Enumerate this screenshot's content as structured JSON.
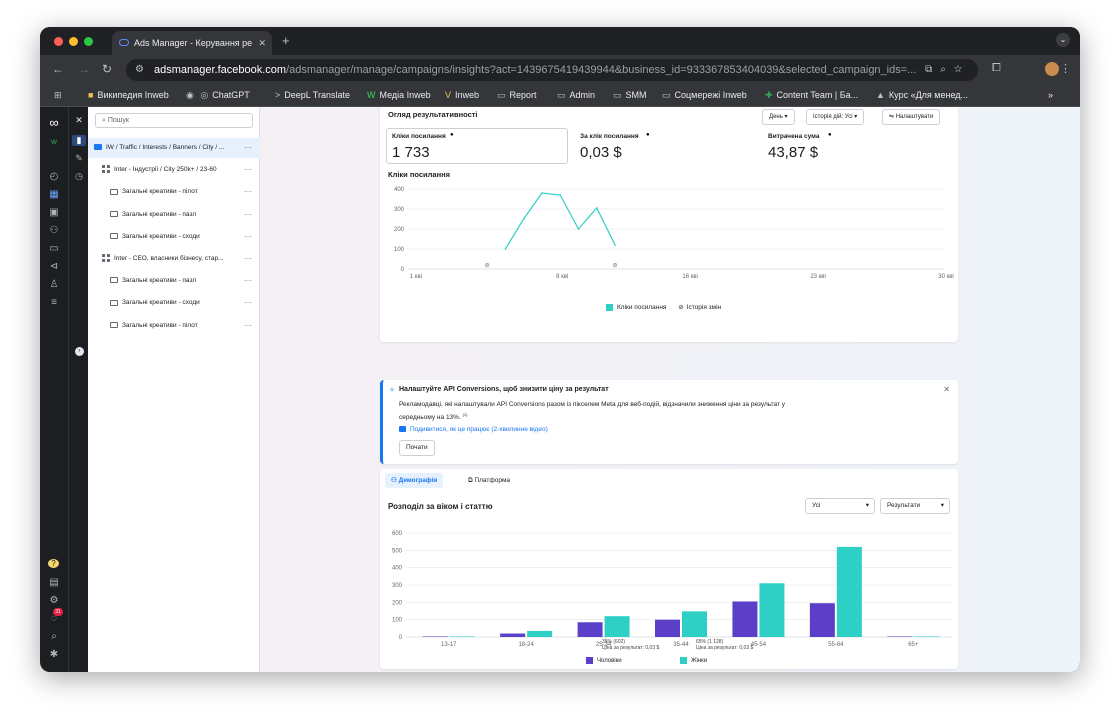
{
  "browser": {
    "tab_title": "Ads Manager - Керування ре",
    "tab_close": "✕",
    "new_tab": "+",
    "url_host": "adsmanager.facebook.com",
    "url_path": "/adsmanager/manage/campaigns/insights?act=1439675419439944&business_id=933367853404039&selected_campaign_ids=...",
    "menu": "⌄",
    "bookmarks": [
      "Википедия Inweb",
      "ChatGPT",
      "DeepL Translate",
      "Медіа Inweb",
      "Inweb",
      "Report",
      "Admin",
      "SMM",
      "Соцмережі Inweb",
      "Content Team | Ба...",
      "Курс «Для менед..."
    ],
    "bookmarks_more": "»"
  },
  "tree": {
    "search_placeholder": "Пошук",
    "rows": [
      {
        "label": "IW / Traffic / Interests / Banners / City / ...",
        "kind": "campaign",
        "indent": 0
      },
      {
        "label": "Inter - Індустрії / City 250k+ / 23-60",
        "kind": "adset",
        "indent": 1
      },
      {
        "label": "Загальні креативи - пілот",
        "kind": "ad",
        "indent": 2
      },
      {
        "label": "Загальні креативи - пазл",
        "kind": "ad",
        "indent": 2
      },
      {
        "label": "Загальні креативи - сходи",
        "kind": "ad",
        "indent": 2
      },
      {
        "label": "Inter - CEO, власники бізнесу, стар...",
        "kind": "adset",
        "indent": 1
      },
      {
        "label": "Загальні креативи - пазл",
        "kind": "ad",
        "indent": 2
      },
      {
        "label": "Загальні креативи - сходи",
        "kind": "ad",
        "indent": 2
      },
      {
        "label": "Загальні креативи - пілот",
        "kind": "ad",
        "indent": 2
      }
    ],
    "more": "···"
  },
  "overview": {
    "title": "Огляд результативності",
    "btn_day": "День ▾",
    "btn_history": "Історія дій: Усі ▾",
    "btn_settings": "Налаштувати",
    "metrics": [
      {
        "label": "Кліки посилання",
        "value": "1 733"
      },
      {
        "label": "За клік посилання",
        "value": "0,03 $"
      },
      {
        "label": "Витрачена сума",
        "value": "43,87 $"
      }
    ],
    "chart_title": "Кліки посилання",
    "legend_clicks": "Кліки посилання",
    "legend_history": "Історія змін"
  },
  "banner": {
    "title": "Налаштуйте API Conversions, щоб знизити ціну за результат",
    "body": "Рекламодавці, які налаштували API Conversions разом із пікселем Meta для веб-подій, відзначили зниження ціни за результат у середньому на 13%.",
    "footnote": "(1)",
    "video_link": "Подивитися, як це працює (2-хвилинне відео)",
    "start": "Почати",
    "close": "✕"
  },
  "breakdown": {
    "tab_demo": "Демографія",
    "tab_platform": "Платформа",
    "title": "Розподіл за віком і статтю",
    "select_all": "Усі",
    "select_results": "Результати",
    "men_label": "Чоловіки",
    "men_share": "35% (602)",
    "men_cpr": "Ціна за результат: 0,03 $",
    "women_label": "Жінки",
    "women_share": "65% (1 128)",
    "women_cpr": "Ціна за результат: 0,03 $"
  },
  "colors": {
    "men": "#5b3fc9",
    "women": "#2ecfc4",
    "line": "#2ecfc4",
    "accent": "#1877f2"
  },
  "chart_data": [
    {
      "type": "line",
      "title": "Кліки посилання",
      "x_ticks": [
        "1 кві",
        "8 кві",
        "16 кві",
        "23 кві",
        "30 кві"
      ],
      "ylim": [
        0,
        400
      ],
      "y_ticks": [
        0,
        100,
        200,
        300,
        400
      ],
      "series": [
        {
          "name": "Кліки посилання",
          "x": [
            6,
            7,
            8,
            9,
            10,
            11,
            12
          ],
          "y": [
            100,
            250,
            380,
            370,
            200,
            305,
            120
          ]
        }
      ],
      "markers_x": [
        5,
        12
      ]
    },
    {
      "type": "bar",
      "title": "Розподіл за віком і статтю",
      "categories": [
        "13-17",
        "18-24",
        "25-34",
        "35-44",
        "45-54",
        "55-64",
        "65+"
      ],
      "ylim": [
        0,
        600
      ],
      "y_ticks": [
        0,
        100,
        200,
        300,
        400,
        500,
        600
      ],
      "series": [
        {
          "name": "Чоловіки",
          "values": [
            3,
            20,
            85,
            100,
            205,
            195,
            3
          ]
        },
        {
          "name": "Жінки",
          "values": [
            3,
            35,
            120,
            148,
            310,
            520,
            3
          ]
        }
      ]
    }
  ]
}
